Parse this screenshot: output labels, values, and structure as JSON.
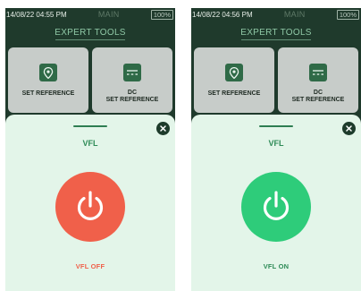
{
  "screens": [
    {
      "status": {
        "datetime": "14/08/22 04:55 PM",
        "mode": "MAIN",
        "battery": "100%"
      },
      "section_title": "EXPERT TOOLS",
      "tiles": [
        {
          "label": "SET REFERENCE",
          "icon": "location-pin-icon"
        },
        {
          "label": "DC\nSET REFERENCE",
          "icon": "dc-symbol-icon"
        }
      ],
      "sheet": {
        "title": "VFL",
        "state_label": "VFL OFF",
        "state": "off",
        "button_color": "#f0604a",
        "label_color": "#f0604a"
      }
    },
    {
      "status": {
        "datetime": "14/08/22 04:56 PM",
        "mode": "MAIN",
        "battery": "100%"
      },
      "section_title": "EXPERT TOOLS",
      "tiles": [
        {
          "label": "SET REFERENCE",
          "icon": "location-pin-icon"
        },
        {
          "label": "DC\nSET REFERENCE",
          "icon": "dc-symbol-icon"
        }
      ],
      "sheet": {
        "title": "VFL",
        "state_label": "VFL ON",
        "state": "on",
        "button_color": "#2ecc7a",
        "label_color": "#2e8b57"
      }
    }
  ]
}
